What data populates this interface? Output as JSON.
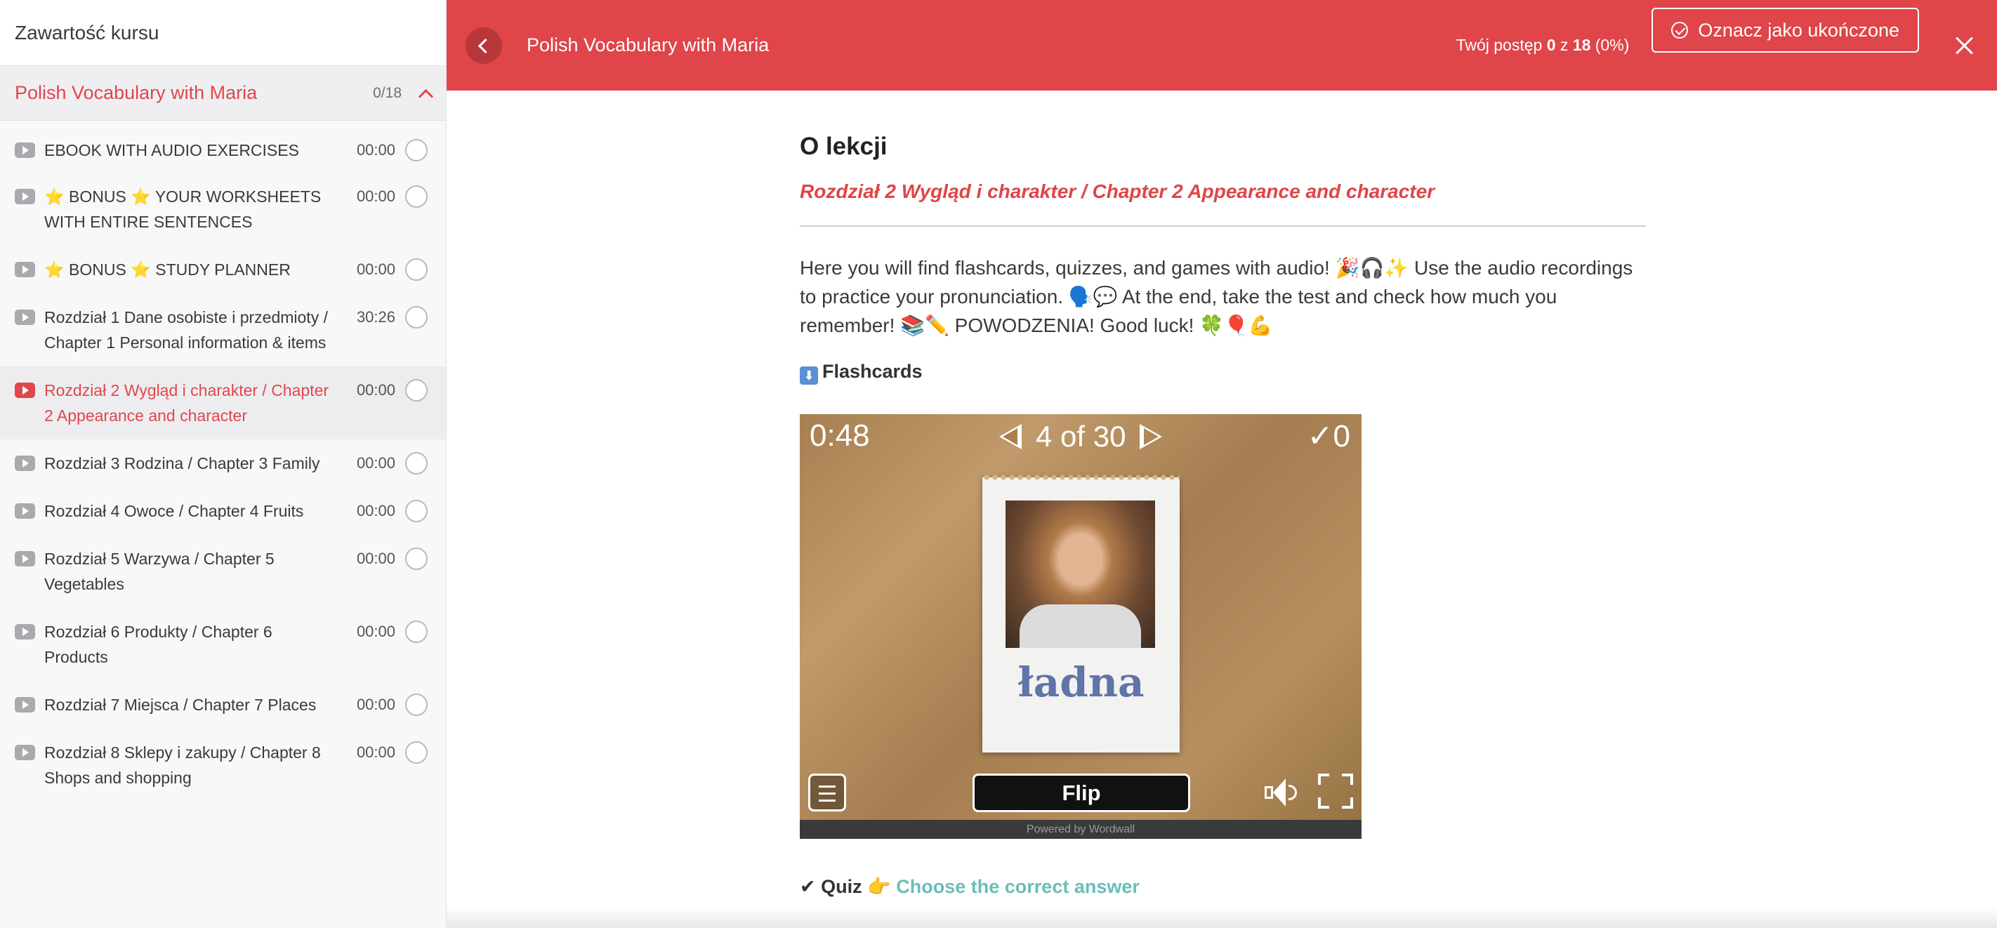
{
  "sidebar": {
    "title": "Zawartość kursu",
    "section": {
      "name": "Polish Vocabulary with Maria",
      "count": "0/18"
    },
    "lessons": [
      {
        "title": "EBOOK WITH AUDIO EXERCISES",
        "duration": "00:00",
        "active": false
      },
      {
        "title": "⭐ BONUS ⭐ YOUR WORKSHEETS WITH ENTIRE SENTENCES",
        "duration": "00:00",
        "active": false
      },
      {
        "title": "⭐ BONUS ⭐ STUDY PLANNER",
        "duration": "00:00",
        "active": false
      },
      {
        "title": "Rozdział 1 Dane osobiste i przedmioty / Chapter 1 Personal information & items",
        "duration": "30:26",
        "active": false
      },
      {
        "title": "Rozdział 2 Wygląd i charakter / Chapter 2 Appearance and character",
        "duration": "00:00",
        "active": true
      },
      {
        "title": "Rozdział 3 Rodzina / Chapter 3 Family",
        "duration": "00:00",
        "active": false
      },
      {
        "title": "Rozdział 4 Owoce / Chapter 4 Fruits",
        "duration": "00:00",
        "active": false
      },
      {
        "title": "Rozdział 5 Warzywa / Chapter 5 Vegetables",
        "duration": "00:00",
        "active": false
      },
      {
        "title": "Rozdział 6 Produkty / Chapter 6 Products",
        "duration": "00:00",
        "active": false
      },
      {
        "title": "Rozdział 7 Miejsca / Chapter 7 Places",
        "duration": "00:00",
        "active": false
      },
      {
        "title": "Rozdział 8 Sklepy i zakupy / Chapter 8 Shops and shopping",
        "duration": "00:00",
        "active": false
      }
    ]
  },
  "topbar": {
    "course_title": "Polish Vocabulary with Maria",
    "progress_prefix": "Twój postęp",
    "progress_done": "0",
    "progress_of": "z",
    "progress_total": "18",
    "progress_pct": "(0%)",
    "mark_complete": "Oznacz jako ukończone"
  },
  "content": {
    "about_title": "O lekcji",
    "chapter_subtitle": "Rozdział 2 Wygląd i charakter / Chapter 2 Appearance and character",
    "description": "Here you will find flashcards, quizzes, and games with audio! 🎉🎧✨ Use the audio recordings to practice your pronunciation. 🗣️💬 At the end, take the test and check how much you remember! 📚✏️ POWODZENIA! Good luck! 🍀🎈💪",
    "flashcards_label": "Flashcards",
    "quiz_label": "✔ Quiz 👉",
    "quiz_link": "Choose the correct answer"
  },
  "wordwall": {
    "timer": "0:48",
    "position": "4 of 30",
    "score": "✓0",
    "card_word": "ładna",
    "flip_label": "Flip",
    "powered_by": "Powered by Wordwall"
  },
  "colors": {
    "brand_red": "#df4549",
    "quiz_link": "#6bbdb7"
  }
}
